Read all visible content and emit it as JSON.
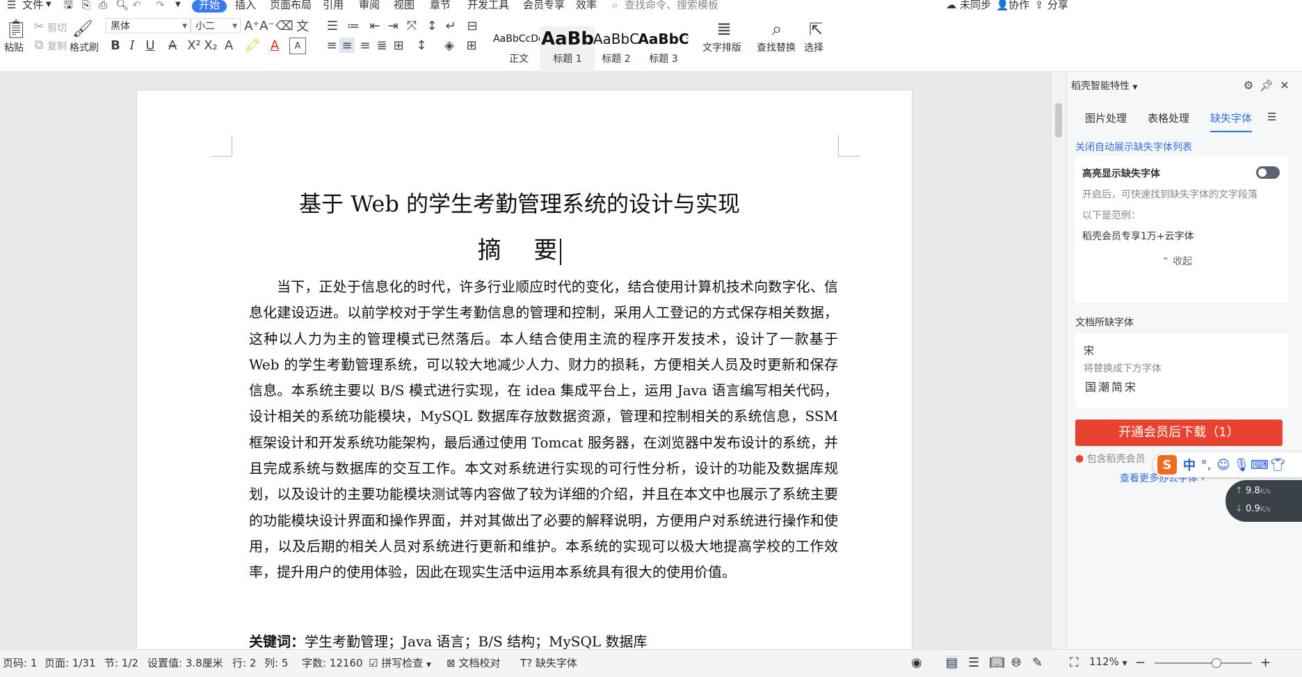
{
  "menubar": {
    "items": [
      "文件",
      "开始",
      "插入",
      "页面布局",
      "引用",
      "审阅",
      "视图",
      "章节",
      "开发工具",
      "会员专享",
      "效率"
    ],
    "search_placeholder": "查找命令、搜索模板",
    "sync_status": "未同步",
    "collab": "协作",
    "share": "分享"
  },
  "ribbon": {
    "paste": "粘贴",
    "cut": "剪切",
    "copy": "复制",
    "format_painter": "格式刷",
    "font_name": "黑体",
    "font_size": "小二",
    "styles": [
      {
        "sample": "AaBbCcDd",
        "name": "正文"
      },
      {
        "sample": "AaBb",
        "name": "标题 1"
      },
      {
        "sample": "AaBbC",
        "name": "标题 2"
      },
      {
        "sample": "AaBbC",
        "name": "标题 3"
      }
    ],
    "text_layout": "文字排版",
    "find_replace": "查找替换",
    "select": "选择"
  },
  "document": {
    "title": "基于 Web 的学生考勤管理系统的设计与实现",
    "subtitle": "摘 要",
    "abstract": "当下，正处于信息化的时代，许多行业顺应时代的变化，结合使用计算机技术向数字化、信息化建设迈进。以前学校对于学生考勤信息的管理和控制，采用人工登记的方式保存相关数据，这种以人力为主的管理模式已然落后。本人结合使用主流的程序开发技术，设计了一款基于 Web 的学生考勤管理系统，可以较大地减少人力、财力的损耗，方便相关人员及时更新和保存信息。本系统主要以 B/S 模式进行实现，在 idea 集成平台上，运用 Java 语言编写相关代码，设计相关的系统功能模块，MySQL 数据库存放数据资源，管理和控制相关的系统信息，SSM 框架设计和开发系统功能架构，最后通过使用 Tomcat 服务器，在浏览器中发布设计的系统，并且完成系统与数据库的交互工作。本文对系统进行实现的可行性分析，设计的功能及数据库规划，以及设计的主要功能模块测试等内容做了较为详细的介绍，并且在本文中也展示了系统主要的功能模块设计界面和操作界面，并对其做出了必要的解释说明，方便用户对系统进行操作和使用，以及后期的相关人员对系统进行更新和维护。本系统的实现可以极大地提高学校的工作效率，提升用户的使用体验，因此在现实生活中运用本系统具有很大的使用价值。",
    "keywords_label": "关键词：",
    "keywords": "学生考勤管理；Java 语言；B/S 结构；MySQL 数据库"
  },
  "panel": {
    "header": "稻壳智能特性",
    "tabs": [
      "图片处理",
      "表格处理",
      "缺失字体"
    ],
    "close_auto_link": "关闭自动展示缺失字体列表",
    "highlight_title": "高亮显示缺失字体",
    "highlight_desc": "开启后，可快速找到缺失字体的文字段落",
    "example_label": "以下是范例：",
    "example_value": "稻壳会员专享1万+云字体",
    "collapse": "收起",
    "missing_title": "文档所缺字体",
    "missing_font": "宋",
    "replace_hint": "将替换成下方字体",
    "replace_font": "国潮简宋",
    "download_btn": "开通会员后下载（1）",
    "member_note": "包含稻壳会员",
    "more_link": "查看更多办公字体"
  },
  "ime": {
    "mode": "中",
    "net_up": "9.8",
    "net_down": "0.9",
    "net_unit": "K/s"
  },
  "status": {
    "page_code": "页码: 1",
    "page": "页面: 1/31",
    "section": "节: 1/2",
    "setting": "设置值: 3.8厘米",
    "row": "行: 2",
    "col": "列: 5",
    "wordcount": "字数: 12160",
    "spellcheck": "拼写检查",
    "doc_check": "文档校对",
    "missing_font": "缺失字体",
    "zoom": "112%"
  }
}
